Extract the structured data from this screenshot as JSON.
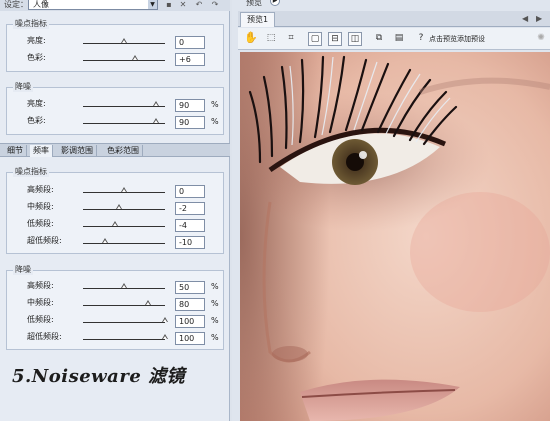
{
  "settings": {
    "label": "设定：",
    "value": "人像"
  },
  "top_icons": [
    "save-icon",
    "delete-icon",
    "undo-icon",
    "redo-icon"
  ],
  "noise_group": {
    "title": "噪点指标",
    "rows": [
      {
        "label": "亮度:",
        "value": "0",
        "position": 0.5
      },
      {
        "label": "色彩:",
        "value": "+6",
        "position": 0.64
      }
    ]
  },
  "reduce_group": {
    "title": "降噪",
    "rows": [
      {
        "label": "亮度:",
        "value": "90",
        "unit": "%",
        "position": 0.9
      },
      {
        "label": "色彩:",
        "value": "90",
        "unit": "%",
        "position": 0.9
      }
    ]
  },
  "tabs": [
    "细节",
    "频率",
    "影调范围",
    "色彩范围"
  ],
  "active_tab": 1,
  "freq_noise_group": {
    "title": "噪点指标",
    "rows": [
      {
        "label": "高频段:",
        "value": "0",
        "position": 0.5
      },
      {
        "label": "中频段:",
        "value": "-2",
        "position": 0.45
      },
      {
        "label": "低频段:",
        "value": "-4",
        "position": 0.4
      },
      {
        "label": "超低频段:",
        "value": "-10",
        "position": 0.27
      }
    ]
  },
  "freq_reduce_group": {
    "title": "降噪",
    "rows": [
      {
        "label": "高频段:",
        "value": "50",
        "unit": "%",
        "position": 0.5
      },
      {
        "label": "中频段:",
        "value": "80",
        "unit": "%",
        "position": 0.8
      },
      {
        "label": "低频段:",
        "value": "100",
        "unit": "%",
        "position": 1.0
      },
      {
        "label": "超低频段:",
        "value": "100",
        "unit": "%",
        "position": 1.0
      }
    ]
  },
  "caption": "5.Noiseware 滤镜",
  "preview": {
    "top_label": "预览",
    "tab": "预览1",
    "toolbar_text": "点击预览添加预设",
    "toolbar_icons": [
      "hand-icon",
      "marquee-icon",
      "crop-icon",
      "view-single-icon",
      "view-split-h-icon",
      "view-split-v-icon",
      "export-icon",
      "folder-icon",
      "help-icon",
      "sun-icon"
    ]
  },
  "colors": {
    "panel": "#e6ebf3",
    "border": "#a9b6c9"
  }
}
